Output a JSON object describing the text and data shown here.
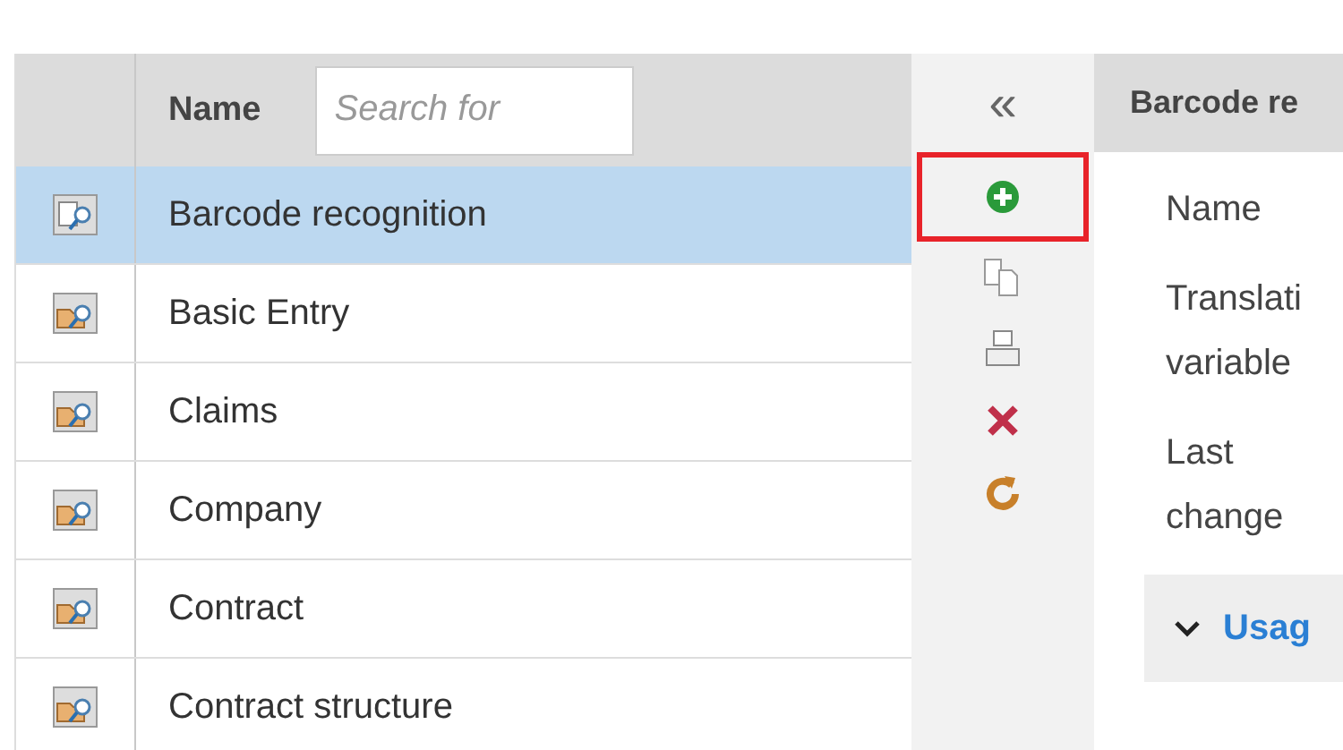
{
  "table": {
    "columns": [
      {
        "label": "Name",
        "search_placeholder": "Search for"
      }
    ],
    "rows": [
      {
        "kind": "document",
        "name": "Barcode recognition",
        "selected": true
      },
      {
        "kind": "folder",
        "name": "Basic Entry",
        "selected": false
      },
      {
        "kind": "folder",
        "name": "Claims",
        "selected": false
      },
      {
        "kind": "folder",
        "name": "Company",
        "selected": false
      },
      {
        "kind": "folder",
        "name": "Contract",
        "selected": false
      },
      {
        "kind": "folder",
        "name": "Contract structure",
        "selected": false
      }
    ]
  },
  "toolbar": {
    "collapse": "«",
    "tools": [
      {
        "kind": "add",
        "highlighted": true
      },
      {
        "kind": "copy",
        "highlighted": false
      },
      {
        "kind": "print",
        "highlighted": false
      },
      {
        "kind": "delete",
        "highlighted": false
      },
      {
        "kind": "refresh",
        "highlighted": false
      }
    ]
  },
  "detail": {
    "title": "Barcode re",
    "fields": [
      [
        "Name"
      ],
      [
        "Translati",
        "variable"
      ],
      [
        "Last",
        "change"
      ]
    ],
    "section": {
      "label": "Usag",
      "expanded": true
    }
  }
}
